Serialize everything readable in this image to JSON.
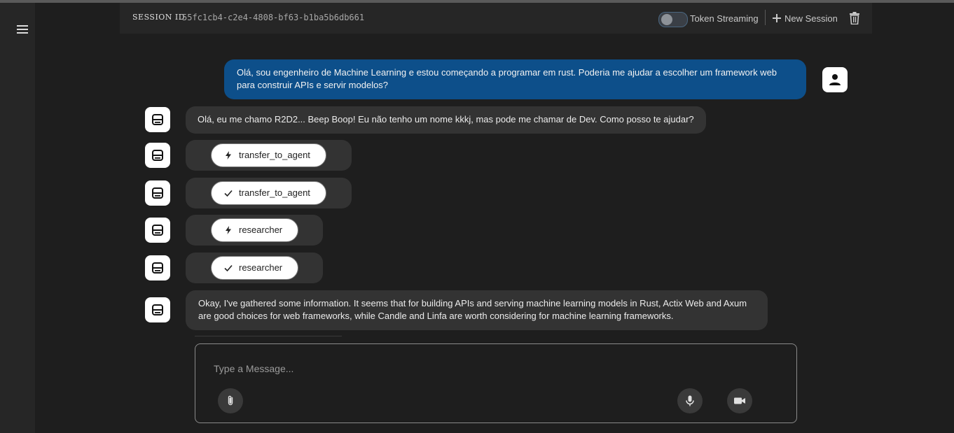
{
  "header": {
    "session_label": "SESSION ID",
    "session_id": "55fc1cb4-c2e4-4808-bf63-b1ba5b6db661",
    "token_streaming_label": "Token Streaming",
    "token_streaming_on": false,
    "new_session_label": "New Session"
  },
  "messages": [
    {
      "role": "user",
      "text": "Olá, sou engenheiro de Machine Learning e estou começando a programar em rust. Poderia me ajudar a escolher um framework web para construir APIs e servir modelos?"
    },
    {
      "role": "bot",
      "text": "Olá, eu me chamo R2D2... Beep Boop! Eu não tenho um nome kkkj, mas pode me chamar de Dev. Como posso te ajudar?"
    },
    {
      "role": "bot",
      "type": "function_call",
      "icon": "bolt-icon",
      "label": "transfer_to_agent"
    },
    {
      "role": "bot",
      "type": "function_response",
      "icon": "check-icon",
      "label": "transfer_to_agent"
    },
    {
      "role": "bot",
      "type": "function_call",
      "icon": "bolt-icon",
      "label": "researcher"
    },
    {
      "role": "bot",
      "type": "function_response",
      "icon": "check-icon",
      "label": "researcher"
    },
    {
      "role": "bot",
      "text": "Okay, I've gathered some information. It seems that for building APIs and serving machine learning models in Rust, Actix Web and Axum are good choices for web frameworks, while Candle and Linfa are worth considering for machine learning frameworks."
    }
  ],
  "composer": {
    "placeholder": "Type a Message..."
  },
  "colors": {
    "user_bubble": "#0d4f8a",
    "bot_bubble": "#333333",
    "background": "#1e1e1e"
  }
}
